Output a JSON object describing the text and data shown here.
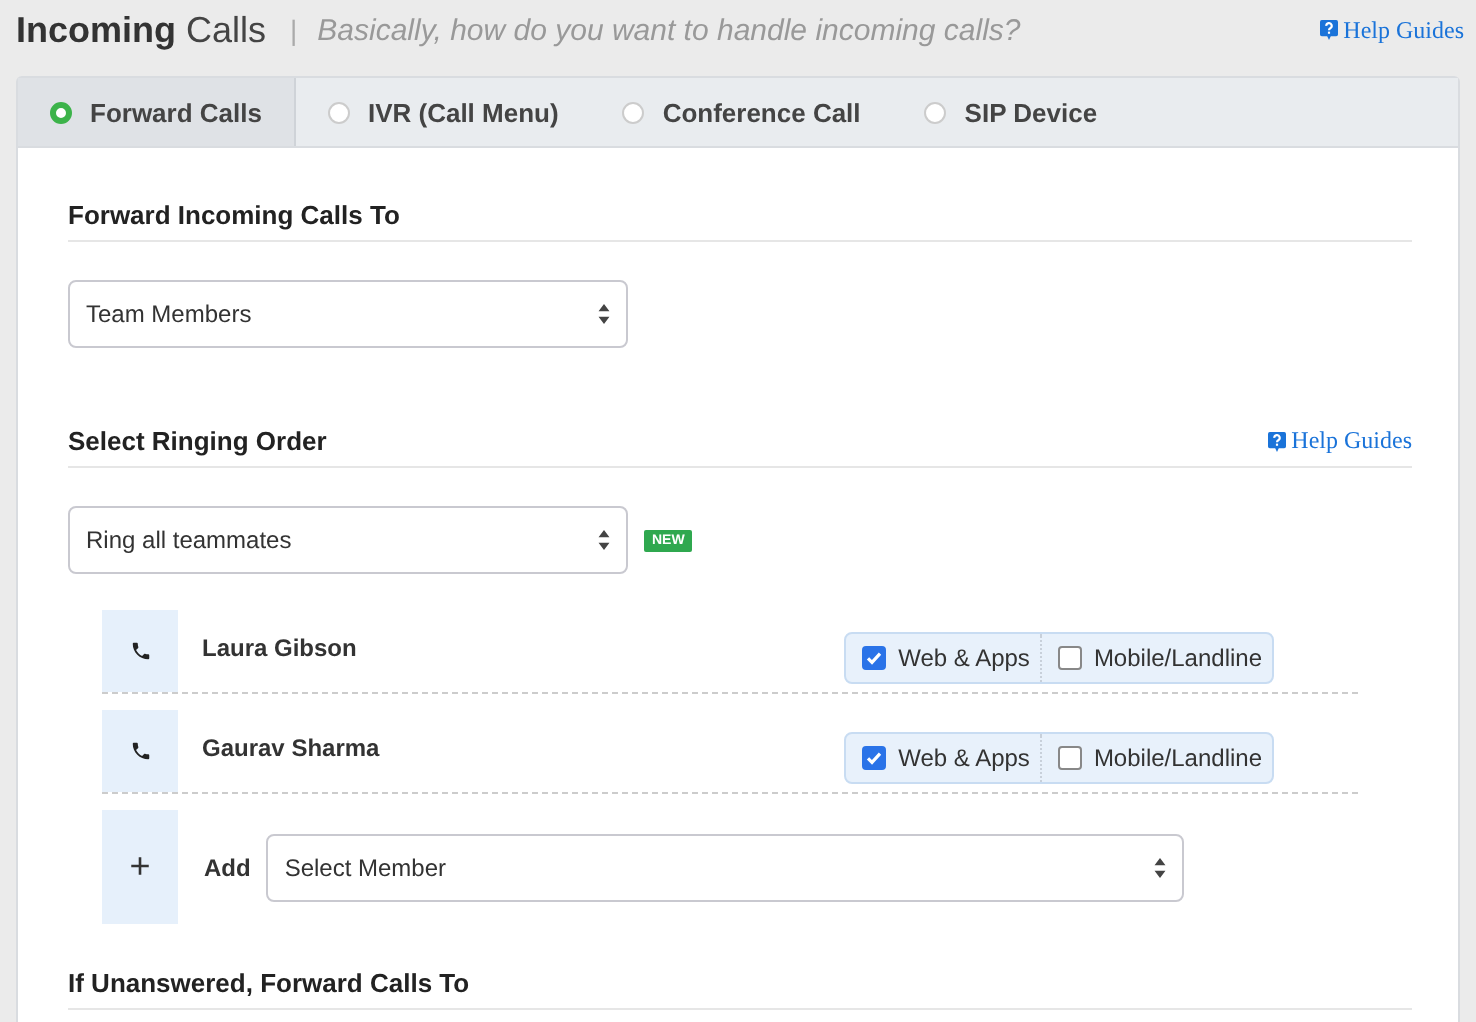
{
  "header": {
    "title_bold": "Incoming",
    "title_rest": "Calls",
    "separator": "|",
    "subtitle": "Basically, how do you want to handle incoming calls?",
    "help": "Help Guides"
  },
  "tabs": [
    {
      "label": "Forward Calls",
      "selected": true
    },
    {
      "label": "IVR (Call Menu)",
      "selected": false
    },
    {
      "label": "Conference Call",
      "selected": false
    },
    {
      "label": "SIP Device",
      "selected": false
    }
  ],
  "forward_to": {
    "heading": "Forward Incoming Calls To",
    "value": "Team Members"
  },
  "ringing": {
    "heading": "Select Ringing Order",
    "help": "Help Guides",
    "value": "Ring all teammates",
    "badge": "NEW"
  },
  "members": [
    {
      "name": "Laura Gibson",
      "options": [
        {
          "label": "Web & Apps",
          "checked": true
        },
        {
          "label": "Mobile/Landline",
          "checked": false
        }
      ]
    },
    {
      "name": "Gaurav Sharma",
      "options": [
        {
          "label": "Web & Apps",
          "checked": true
        },
        {
          "label": "Mobile/Landline",
          "checked": false
        }
      ]
    }
  ],
  "add": {
    "icon": "+",
    "label": "Add",
    "value": "Select Member"
  },
  "unanswered": {
    "heading": "If Unanswered, Forward Calls To"
  }
}
